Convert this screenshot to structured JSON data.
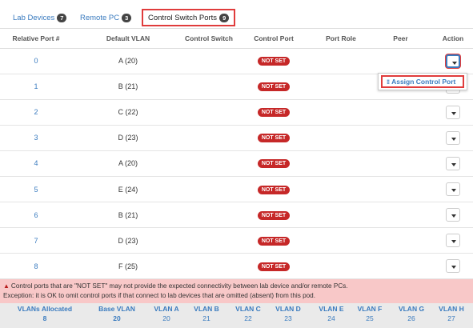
{
  "tabs": [
    {
      "label": "Lab Devices",
      "count": "7"
    },
    {
      "label": "Remote PC",
      "count": "3"
    },
    {
      "label": "Control Switch Ports",
      "count": "9"
    }
  ],
  "table": {
    "headers": [
      "Relative Port #",
      "Default VLAN",
      "Control Switch",
      "Control Port",
      "Port Role",
      "Peer",
      "Action"
    ],
    "rows": [
      {
        "port": "0",
        "vlan": "A (20)",
        "status": "NOT SET"
      },
      {
        "port": "1",
        "vlan": "B (21)",
        "status": "NOT SET"
      },
      {
        "port": "2",
        "vlan": "C (22)",
        "status": "NOT SET"
      },
      {
        "port": "3",
        "vlan": "D (23)",
        "status": "NOT SET"
      },
      {
        "port": "4",
        "vlan": "A (20)",
        "status": "NOT SET"
      },
      {
        "port": "5",
        "vlan": "E (24)",
        "status": "NOT SET"
      },
      {
        "port": "6",
        "vlan": "B (21)",
        "status": "NOT SET"
      },
      {
        "port": "7",
        "vlan": "D (23)",
        "status": "NOT SET"
      },
      {
        "port": "8",
        "vlan": "F (25)",
        "status": "NOT SET"
      }
    ]
  },
  "menu": {
    "assign_label": "Assign Control Port"
  },
  "warning": {
    "line1": "Control ports that are \"NOT SET\" may not provide the expected connectivity between lab device and/or remote PCs.",
    "line2": "Exception: it is OK to omit control ports if that connect to lab devices that are omitted (absent) from this pod."
  },
  "vlans": [
    {
      "label": "VLANs Allocated",
      "value": "8",
      "bold": true
    },
    {
      "label": "Base VLAN",
      "value": "20",
      "bold": true
    },
    {
      "label": "VLAN A",
      "value": "20"
    },
    {
      "label": "VLAN B",
      "value": "21"
    },
    {
      "label": "VLAN C",
      "value": "22"
    },
    {
      "label": "VLAN D",
      "value": "23"
    },
    {
      "label": "VLAN E",
      "value": "24"
    },
    {
      "label": "VLAN F",
      "value": "25"
    },
    {
      "label": "VLAN G",
      "value": "26"
    },
    {
      "label": "VLAN H",
      "value": "27"
    }
  ],
  "colors": {
    "accent": "#3a7bbf",
    "danger": "#c62828",
    "highlight": "#e03c3c",
    "warning_bg": "#f8c8c8"
  },
  "icons": {
    "warning": "warning-triangle-icon",
    "action": "chevron-down-icon",
    "assign": "network-icon"
  }
}
